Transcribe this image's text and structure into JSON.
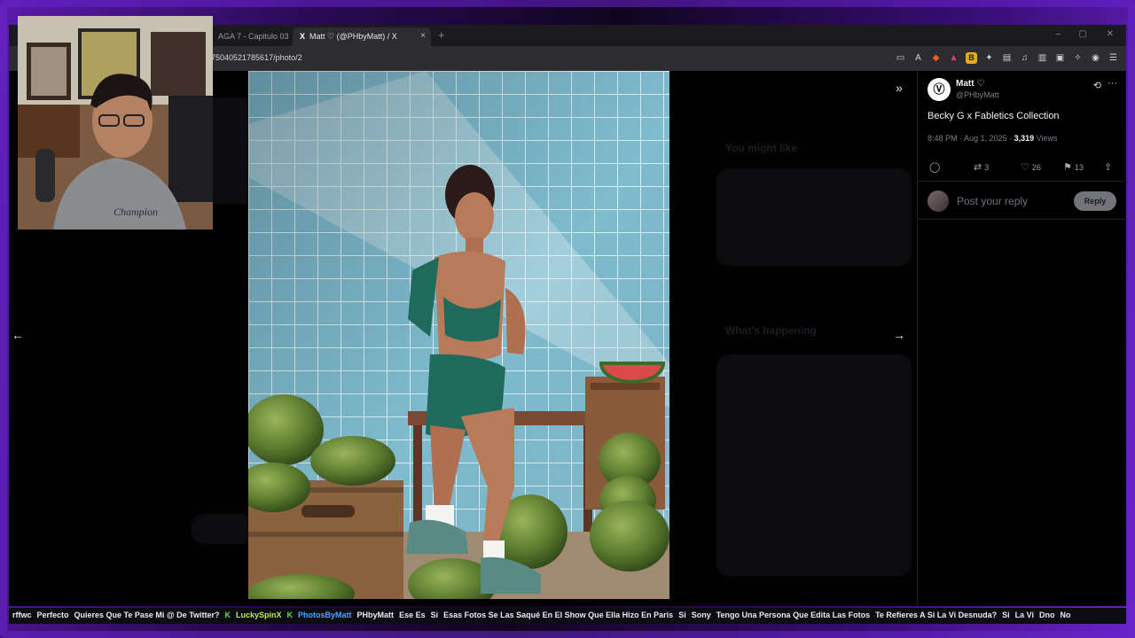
{
  "browser": {
    "tabs": [
      {
        "label": "AGA 7 - Capitulo 03"
      },
      {
        "label": "Matt ♡ (@PHbyMatt) / X",
        "logo": "X"
      }
    ],
    "tab_close": "×",
    "new_tab": "+",
    "url": "75040521785617/photo/2",
    "window_controls": [
      "–",
      "▢",
      "✕"
    ]
  },
  "post": {
    "author_name": "Matt ♡",
    "author_handle": "@PHbyMatt",
    "avatar_initials": "Ⓥ",
    "title": "Becky G x Fabletics Collection",
    "time": "8:48 PM · Aug 1, 2025 · ",
    "views_count": "3,319",
    "views_label": " Views",
    "retweets": "3",
    "likes": "26",
    "bookmarks": "13",
    "reply_placeholder": "Post your reply",
    "reply_button": "Reply"
  },
  "background_sidebar": {
    "ghost_title_1": "You might like",
    "ghost_title_2": "What's happening"
  },
  "nav": {
    "prev": "←",
    "next": "→",
    "collapse": "»"
  },
  "ticker": [
    {
      "text": "rffwc",
      "style": "plain"
    },
    {
      "text": "Perfecto",
      "style": "plain"
    },
    {
      "text": "Quieres Que Te Pase Mi @ De Twitter?",
      "style": "plain"
    },
    {
      "text": "K",
      "style": "badge"
    },
    {
      "text": "LuckySpinX",
      "style": "user-b"
    },
    {
      "text": "K",
      "style": "badge"
    },
    {
      "text": "PhotosByMatt",
      "style": "user-c"
    },
    {
      "text": "PHbyMatt",
      "style": "plain"
    },
    {
      "text": "Ese Es",
      "style": "plain"
    },
    {
      "text": "Si",
      "style": "plain"
    },
    {
      "text": "Esas Fotos Se Las Saqué En El Show Que Ella Hizo En Paris",
      "style": "plain"
    },
    {
      "text": "Si",
      "style": "plain"
    },
    {
      "text": "Sony",
      "style": "plain"
    },
    {
      "text": "Tengo Una Persona Que Edita Las Fotos",
      "style": "plain"
    },
    {
      "text": "Te Refieres A Si La Vi Desnuda?",
      "style": "plain"
    },
    {
      "text": "Si",
      "style": "plain"
    },
    {
      "text": "La Vi",
      "style": "plain"
    },
    {
      "text": "Dno",
      "style": "plain"
    },
    {
      "text": "No",
      "style": "plain"
    }
  ]
}
